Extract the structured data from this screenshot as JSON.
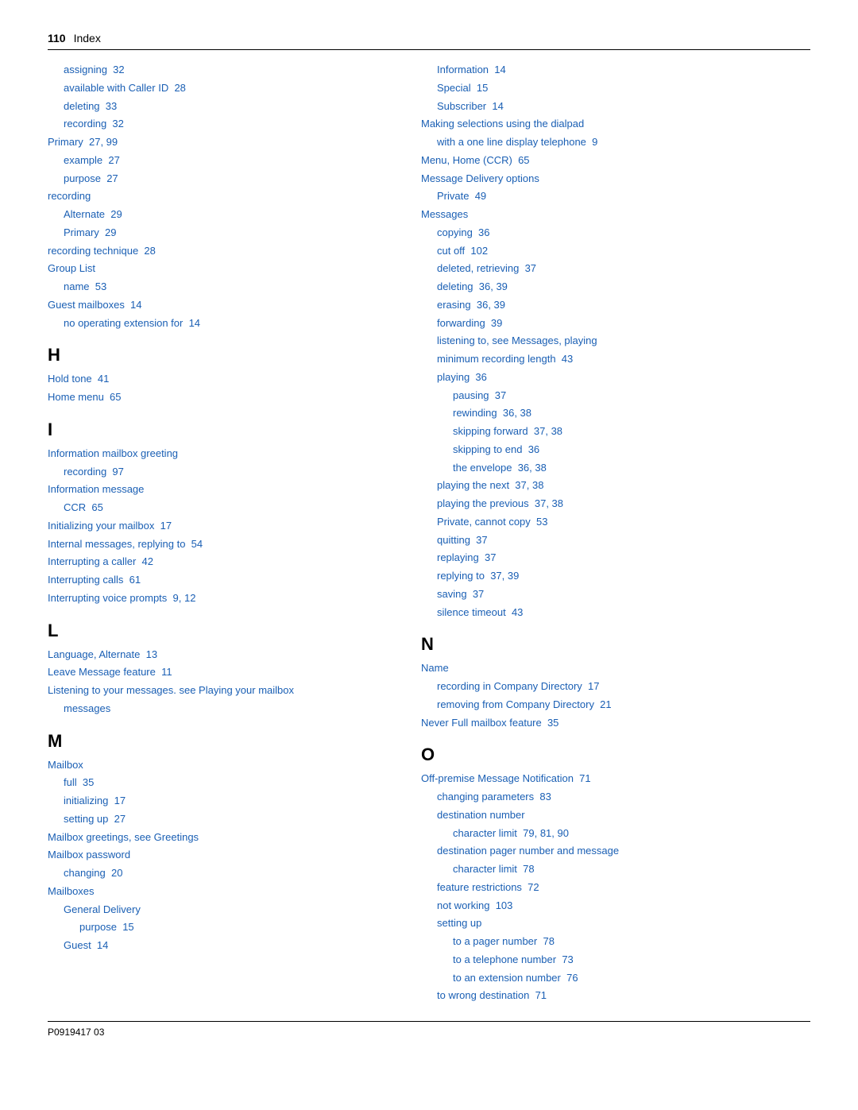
{
  "header": {
    "page_number": "110",
    "section": "Index"
  },
  "footer": {
    "label": "P0919417 03"
  },
  "left_column": {
    "entries": [
      {
        "indent": 1,
        "text": "assigning",
        "page": "32"
      },
      {
        "indent": 1,
        "text": "available with Caller ID",
        "page": "28"
      },
      {
        "indent": 1,
        "text": "deleting",
        "page": "33"
      },
      {
        "indent": 1,
        "text": "recording",
        "page": "32"
      },
      {
        "indent": 0,
        "text": "Primary",
        "page": "27, 99"
      },
      {
        "indent": 1,
        "text": "example",
        "page": "27"
      },
      {
        "indent": 1,
        "text": "purpose",
        "page": "27"
      },
      {
        "indent": 0,
        "text": "recording",
        "page": ""
      },
      {
        "indent": 1,
        "text": "Alternate",
        "page": "29"
      },
      {
        "indent": 1,
        "text": "Primary",
        "page": "29"
      },
      {
        "indent": 0,
        "text": "recording technique",
        "page": "28"
      },
      {
        "indent": 0,
        "text": "Group List",
        "page": ""
      },
      {
        "indent": 1,
        "text": "name",
        "page": "53"
      },
      {
        "indent": 0,
        "text": "Guest mailboxes",
        "page": "14"
      },
      {
        "indent": 1,
        "text": "no operating extension for",
        "page": "14"
      }
    ],
    "section_h": {
      "letter": "H",
      "entries": [
        {
          "indent": 0,
          "text": "Hold tone",
          "page": "41"
        },
        {
          "indent": 0,
          "text": "Home menu",
          "page": "65"
        }
      ]
    },
    "section_i": {
      "letter": "I",
      "entries": [
        {
          "indent": 0,
          "text": "Information mailbox greeting",
          "page": ""
        },
        {
          "indent": 1,
          "text": "recording",
          "page": "97"
        },
        {
          "indent": 0,
          "text": "Information message",
          "page": ""
        },
        {
          "indent": 1,
          "text": "CCR",
          "page": "65"
        },
        {
          "indent": 0,
          "text": "Initializing your mailbox",
          "page": "17"
        },
        {
          "indent": 0,
          "text": "Internal messages, replying to",
          "page": "54"
        },
        {
          "indent": 0,
          "text": "Interrupting a caller",
          "page": "42"
        },
        {
          "indent": 0,
          "text": "Interrupting calls",
          "page": "61"
        },
        {
          "indent": 0,
          "text": "Interrupting voice prompts",
          "page": "9, 12"
        }
      ]
    },
    "section_l": {
      "letter": "L",
      "entries": [
        {
          "indent": 0,
          "text": "Language, Alternate",
          "page": "13"
        },
        {
          "indent": 0,
          "text": "Leave Message feature",
          "page": "11"
        },
        {
          "indent": 0,
          "text": "Listening to your messages. see Playing your mailbox messages",
          "page": ""
        }
      ]
    },
    "section_m": {
      "letter": "M",
      "entries": [
        {
          "indent": 0,
          "text": "Mailbox",
          "page": ""
        },
        {
          "indent": 1,
          "text": "full",
          "page": "35"
        },
        {
          "indent": 1,
          "text": "initializing",
          "page": "17"
        },
        {
          "indent": 1,
          "text": "setting up",
          "page": "27"
        },
        {
          "indent": 0,
          "text": "Mailbox greetings, see Greetings",
          "page": ""
        },
        {
          "indent": 0,
          "text": "Mailbox password",
          "page": ""
        },
        {
          "indent": 1,
          "text": "changing",
          "page": "20"
        },
        {
          "indent": 0,
          "text": "Mailboxes",
          "page": ""
        },
        {
          "indent": 1,
          "text": "General Delivery",
          "page": ""
        },
        {
          "indent": 2,
          "text": "purpose",
          "page": "15"
        },
        {
          "indent": 1,
          "text": "Guest",
          "page": "14"
        }
      ]
    }
  },
  "right_column": {
    "mailboxes_continued": [
      {
        "indent": 1,
        "text": "Information",
        "page": "14"
      },
      {
        "indent": 1,
        "text": "Special",
        "page": "15"
      },
      {
        "indent": 1,
        "text": "Subscriber",
        "page": "14"
      }
    ],
    "entries_top": [
      {
        "indent": 0,
        "text": "Making selections using the dialpad",
        "page": ""
      },
      {
        "indent": 1,
        "text": "with a one line display telephone",
        "page": "9"
      },
      {
        "indent": 0,
        "text": "Menu, Home (CCR)",
        "page": "65"
      },
      {
        "indent": 0,
        "text": "Message Delivery options",
        "page": ""
      },
      {
        "indent": 1,
        "text": "Private",
        "page": "49"
      },
      {
        "indent": 0,
        "text": "Messages",
        "page": ""
      },
      {
        "indent": 1,
        "text": "copying",
        "page": "36"
      },
      {
        "indent": 1,
        "text": "cut off",
        "page": "102"
      },
      {
        "indent": 1,
        "text": "deleted, retrieving",
        "page": "37"
      },
      {
        "indent": 1,
        "text": "deleting",
        "page": "36, 39"
      },
      {
        "indent": 1,
        "text": "erasing",
        "page": "36, 39"
      },
      {
        "indent": 1,
        "text": "forwarding",
        "page": "39"
      },
      {
        "indent": 1,
        "text": "listening to, see Messages, playing",
        "page": ""
      },
      {
        "indent": 1,
        "text": "minimum recording length",
        "page": "43"
      },
      {
        "indent": 1,
        "text": "playing",
        "page": "36"
      },
      {
        "indent": 2,
        "text": "pausing",
        "page": "37"
      },
      {
        "indent": 2,
        "text": "rewinding",
        "page": "36, 38"
      },
      {
        "indent": 2,
        "text": "skipping forward",
        "page": "37, 38"
      },
      {
        "indent": 2,
        "text": "skipping to end",
        "page": "36"
      },
      {
        "indent": 2,
        "text": "the envelope",
        "page": "36, 38"
      },
      {
        "indent": 1,
        "text": "playing the next",
        "page": "37, 38"
      },
      {
        "indent": 1,
        "text": "playing the previous",
        "page": "37, 38"
      },
      {
        "indent": 1,
        "text": "Private, cannot copy",
        "page": "53"
      },
      {
        "indent": 1,
        "text": "quitting",
        "page": "37"
      },
      {
        "indent": 1,
        "text": "replaying",
        "page": "37"
      },
      {
        "indent": 1,
        "text": "replying to",
        "page": "37, 39"
      },
      {
        "indent": 1,
        "text": "saving",
        "page": "37"
      },
      {
        "indent": 1,
        "text": "silence timeout",
        "page": "43"
      }
    ],
    "section_n": {
      "letter": "N",
      "entries": [
        {
          "indent": 0,
          "text": "Name",
          "page": ""
        },
        {
          "indent": 1,
          "text": "recording in Company Directory",
          "page": "17"
        },
        {
          "indent": 1,
          "text": "removing from Company Directory",
          "page": "21"
        },
        {
          "indent": 0,
          "text": "Never Full mailbox feature",
          "page": "35"
        }
      ]
    },
    "section_o": {
      "letter": "O",
      "entries": [
        {
          "indent": 0,
          "text": "Off-premise Message Notification",
          "page": "71"
        },
        {
          "indent": 1,
          "text": "changing parameters",
          "page": "83"
        },
        {
          "indent": 1,
          "text": "destination number",
          "page": ""
        },
        {
          "indent": 2,
          "text": "character limit",
          "page": "79, 81, 90"
        },
        {
          "indent": 1,
          "text": "destination pager number and message",
          "page": ""
        },
        {
          "indent": 2,
          "text": "character limit",
          "page": "78"
        },
        {
          "indent": 1,
          "text": "feature restrictions",
          "page": "72"
        },
        {
          "indent": 1,
          "text": "not working",
          "page": "103"
        },
        {
          "indent": 1,
          "text": "setting up",
          "page": ""
        },
        {
          "indent": 2,
          "text": "to a pager number",
          "page": "78"
        },
        {
          "indent": 2,
          "text": "to a telephone number",
          "page": "73"
        },
        {
          "indent": 2,
          "text": "to an extension number",
          "page": "76"
        },
        {
          "indent": 1,
          "text": "to wrong destination",
          "page": "71"
        }
      ]
    }
  }
}
